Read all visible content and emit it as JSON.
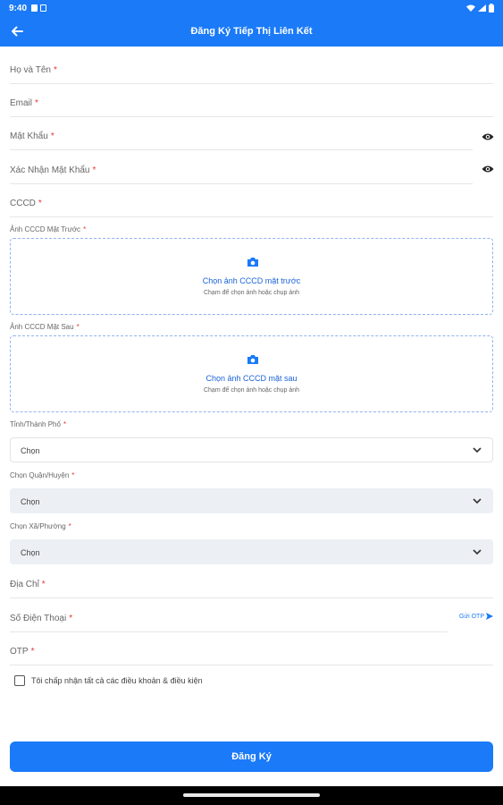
{
  "status_bar": {
    "time": "9:40"
  },
  "header": {
    "title": "Đăng Ký Tiếp Thị Liên Kết"
  },
  "form": {
    "full_name_label": "Họ và Tên",
    "email_label": "Email",
    "password_label": "Mật Khẩu",
    "confirm_password_label": "Xác Nhận Mật Khẩu",
    "id_number_label": "CCCD",
    "id_front": {
      "label": "Ảnh CCCD Mặt Trước",
      "title": "Chọn ảnh CCCD mặt trước",
      "subtitle": "Chạm để chọn ảnh hoặc chụp ảnh"
    },
    "id_back": {
      "label": "Ảnh CCCD Mặt Sau",
      "title": "Chọn ảnh CCCD mặt sau",
      "subtitle": "Chạm để chọn ảnh hoặc chụp ảnh"
    },
    "province": {
      "label": "Tỉnh/Thành Phố",
      "value": "Chọn"
    },
    "district": {
      "label": "Chọn Quận/Huyện",
      "value": "Chọn"
    },
    "ward": {
      "label": "Chọn Xã/Phường",
      "value": "Chọn"
    },
    "address_label": "Địa Chỉ",
    "phone_label": "Số Điện Thoại",
    "send_otp_label": "Gửi OTP",
    "otp_label": "OTP",
    "required_mark": "*",
    "terms_text": "Tôi chấp nhận tất cả các điều khoản & điều kiện",
    "submit_label": "Đăng Ký"
  },
  "colors": {
    "primary": "#1a7af8",
    "required": "#e53935",
    "upload_border": "#8fb4ef"
  }
}
